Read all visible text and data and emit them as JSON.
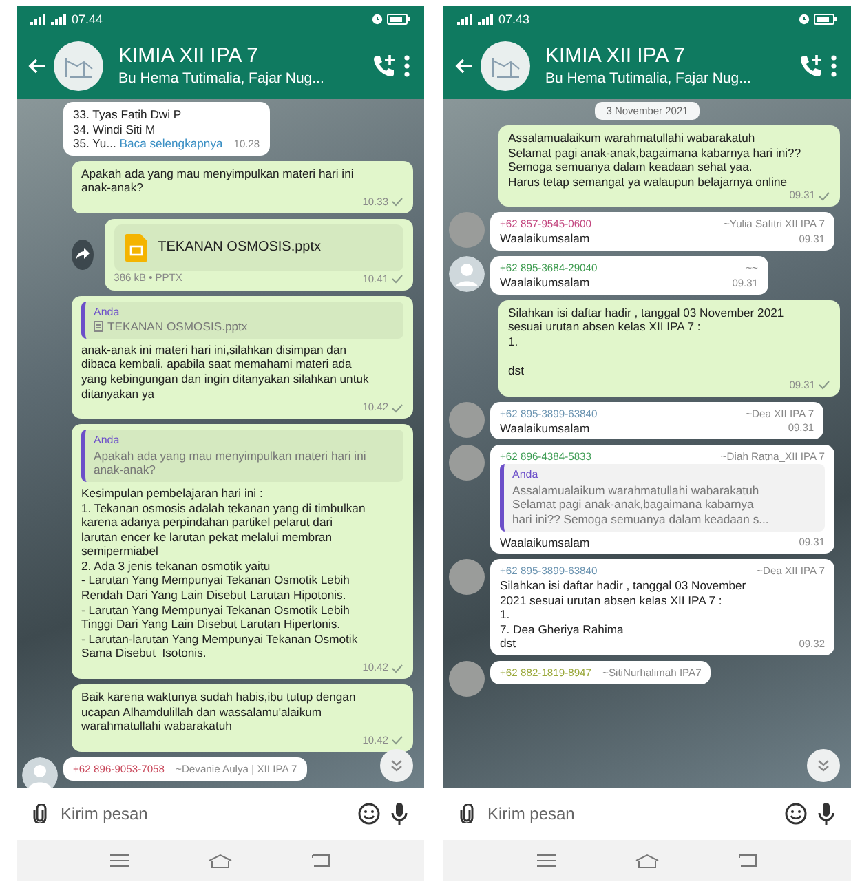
{
  "phones": [
    {
      "status_time": "07.44",
      "title": "KIMIA XII IPA 7",
      "subtitle": "Bu Hema Tutimalia, Fajar Nug...",
      "input": {
        "placeholder": "Kirim pesan"
      },
      "messages": [
        {
          "kind": "incoming",
          "text": "33. Tyas Fatih Dwi P\n34. Windi Siti M\n35. Yu... ",
          "link": "Baca selengkapnya",
          "time": "10.28"
        },
        {
          "kind": "outgoing",
          "text": "Apakah ada yang mau menyimpulkan materi hari ini\nanak-anak?",
          "time": "10.33"
        },
        {
          "kind": "file",
          "file_name": "TEKANAN OSMOSIS.pptx",
          "file_meta": "386 kB • PPTX",
          "time": "10.41"
        },
        {
          "kind": "outgoing",
          "quote": {
            "kind": "file",
            "author": "Anda",
            "text": "TEKANAN OSMOSIS.pptx"
          },
          "text": "anak-anak ini materi hari ini,silahkan disimpan dan\ndibaca kembali. apabila saat memahami materi ada\nyang kebingungan dan ingin ditanyakan silahkan untuk\nditanyakan ya",
          "time": "10.42"
        },
        {
          "kind": "outgoing",
          "quote": {
            "kind": "text",
            "author": "Anda",
            "text": "Apakah ada yang mau menyimpulkan materi hari ini\nanak-anak?"
          },
          "text": "Kesimpulan pembelajaran hari ini :\n1. Tekanan osmosis adalah tekanan yang di timbulkan\nkarena adanya perpindahan partikel pelarut dari\nlarutan encer ke larutan pekat melalui membran\nsemipermiabel\n2. Ada 3 jenis tekanan osmotik yaitu\n- Larutan Yang Mempunyai Tekanan Osmotik Lebih\nRendah Dari Yang Lain Disebut Larutan Hipotonis.\n- Larutan Yang Mempunyai Tekanan Osmotik Lebih\nTinggi Dari Yang Lain Disebut Larutan Hipertonis.\n- Larutan-larutan Yang Mempunyai Tekanan Osmotik\nSama Disebut  Isotonis.",
          "time": "10.42"
        },
        {
          "kind": "outgoing",
          "text": "Baik karena waktunya sudah habis,ibu tutup dengan\nucapan Alhamdulillah dan wassalamu'alaikum\nwarahmatullahi wabarakatuh",
          "time": "10.42"
        },
        {
          "kind": "incoming",
          "avatar_photo": false,
          "sender": "+62 896-9053-7058",
          "color": "#c9485b",
          "name": "~Devanie Aulya | XII IPA 7"
        }
      ]
    },
    {
      "status_time": "07.43",
      "title": "KIMIA XII IPA 7",
      "subtitle": "Bu Hema Tutimalia, Fajar Nug...",
      "input": {
        "placeholder": "Kirim pesan"
      },
      "messages": [
        {
          "kind": "date",
          "text": "3 November 2021"
        },
        {
          "kind": "outgoing",
          "text": "Assalamualaikum warahmatullahi wabarakatuh\nSelamat pagi anak-anak,bagaimana kabarnya hari ini??\nSemoga semuanya dalam keadaan sehat yaa.\nHarus tetap semangat ya walaupun belajarnya online",
          "time": "09.31"
        },
        {
          "kind": "incoming",
          "avatar_photo": true,
          "sender": "+62 857-9545-0600",
          "color": "#c2457e",
          "name": "~Yulia Safitri  XII IPA 7",
          "text": "Waalaikumsalam",
          "time": "09.31"
        },
        {
          "kind": "incoming",
          "avatar_photo": false,
          "sender": "+62 895-3684-29040",
          "color": "#3c9a4e",
          "name": "~~",
          "text": "Waalaikumsalam",
          "time": "09.31"
        },
        {
          "kind": "outgoing",
          "text": "Silahkan isi daftar hadir , tanggal 03 November 2021\nsesuai urutan absen kelas XII IPA 7 :\n1.\n\ndst",
          "time": "09.31"
        },
        {
          "kind": "incoming",
          "avatar_photo": true,
          "sender": "+62 895-3899-63840",
          "color": "#6a93b0",
          "name": "~Dea XII IPA 7",
          "text": "Waalaikumsalam",
          "time": "09.31"
        },
        {
          "kind": "incoming",
          "avatar_photo": true,
          "sender": "+62 896-4384-5833",
          "color": "#3f9d55",
          "name": "~Diah Ratna_XII IPA 7",
          "quote": {
            "kind": "text",
            "author": "Anda",
            "text": "Assalamualaikum warahmatullahi wabarakatuh\nSelamat pagi anak-anak,bagaimana kabarnya\nhari ini?? Semoga semuanya dalam keadaan s..."
          },
          "text": "Waalaikumsalam",
          "time": "09.31"
        },
        {
          "kind": "incoming",
          "avatar_photo": true,
          "sender": "+62 895-3899-63840",
          "color": "#6a93b0",
          "name": "~Dea XII IPA 7",
          "text": "Silahkan isi daftar hadir , tanggal 03 November\n2021 sesuai urutan absen kelas XII IPA 7 :\n1.\n7. Dea Gheriya Rahima\ndst",
          "time": "09.32"
        },
        {
          "kind": "incoming",
          "avatar_photo": true,
          "sender": "+62 882-1819-8947",
          "color": "#9aa83a",
          "name": "~SitiNurhalimah IPA7"
        }
      ]
    }
  ]
}
